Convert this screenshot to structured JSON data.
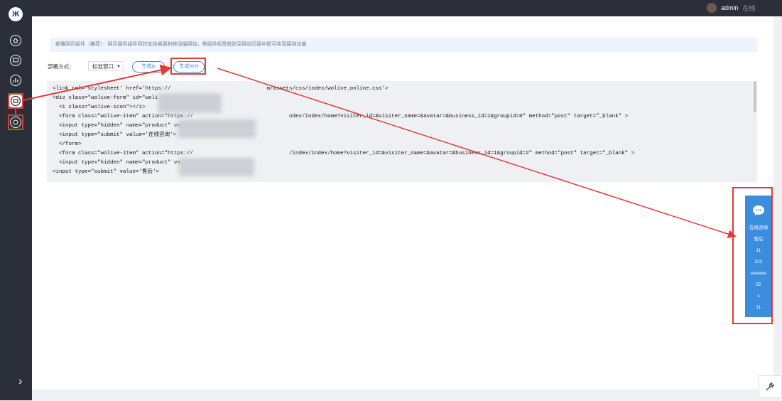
{
  "header": {
    "user_name": "admin",
    "user_status": "在线"
  },
  "sidebar": {
    "logo_text": "Ж",
    "items": [
      {
        "icon": "home-icon"
      },
      {
        "icon": "chat-icon"
      },
      {
        "icon": "stats-icon"
      },
      {
        "icon": "plugin-icon",
        "active": true
      },
      {
        "icon": "settings-icon"
      }
    ],
    "collapse_label": "›"
  },
  "main": {
    "notice": "部署网页组件（推荐）：网页插件组件同时支持桌面和移动端网站，将组件标签粘贴至网站页面中即可实现接待功能",
    "style_label": "部署方式：",
    "window_select": "标准窗口",
    "btn_js": "生成js",
    "btn_html": "生成html",
    "code_lines": [
      "<link rel='stylesheet' href='https://                              m/assets/css/index/wolive_online.css'>",
      "<div class=\"wolive-form\" id=\"woli",
      "  <i class=\"wolive-icon\"></i>",
      "  <form class=\"wolive-item\" action=\"https://                              ndex/index/home?visiter_id=&visiter_name=&avatar=&business_id=1&groupid=0\" method=\"post\" target=\"_blank\" >",
      "  <input type=\"hidden\" name=\"product\" va",
      "  <input type=\"submit\" value='在线咨询'>",
      "  </form>",
      "  <form class=\"wolive-item\" action=\"https://                              /index/index/home?visiter_id=&visiter_name=&avatar=&business_id=1&groupid=2\" method=\"post\" target=\"_blank\" >",
      "  <input type=\"hidden\" name=\"product\" va",
      "<input type=\"submit\" value='售后'>"
    ]
  },
  "widget": {
    "items": [
      "在线咨询",
      "售后",
      "11",
      "222",
      "eeeeee",
      "55",
      "s",
      "11"
    ]
  },
  "colors": {
    "accent": "#3c8dde",
    "annotation": "#e53935",
    "sidebar_bg": "#2b2f3a"
  }
}
